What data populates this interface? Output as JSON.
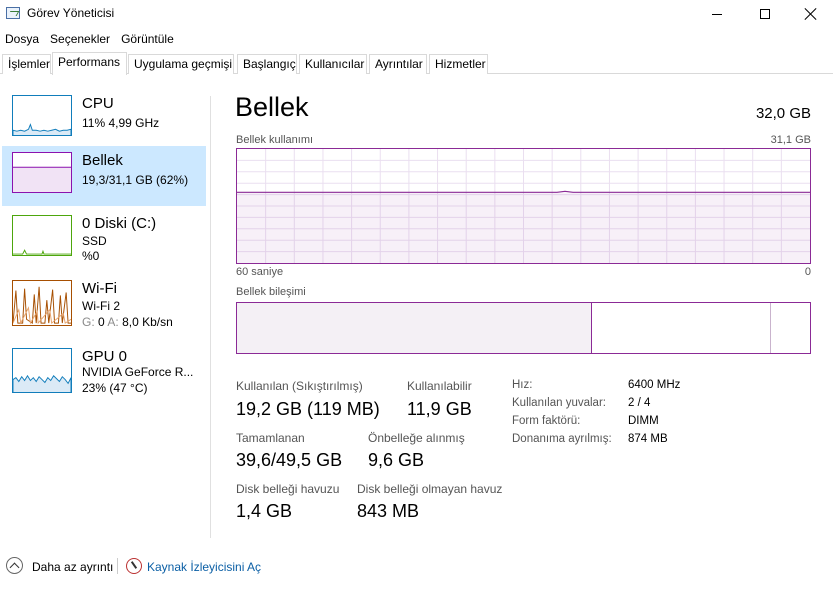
{
  "window": {
    "title": "Görev Yöneticisi"
  },
  "menu": [
    "Dosya",
    "Seçenekler",
    "Görüntüle"
  ],
  "tabs": [
    "İşlemler",
    "Performans",
    "Uygulama geçmişi",
    "Başlangıç",
    "Kullanıcılar",
    "Ayrıntılar",
    "Hizmetler"
  ],
  "active_tab": "Performans",
  "devices": [
    {
      "name": "CPU",
      "line1": "11%  4,99 GHz",
      "color": "#117dbb"
    },
    {
      "name": "Bellek",
      "line1": "19,3/31,1 GB (62%)",
      "color": "#8b12ae",
      "selected": true
    },
    {
      "name": "0 Diski (C:)",
      "line1": "SSD",
      "line2": "%0",
      "color": "#4da60c"
    },
    {
      "name": "Wi-Fi",
      "line1": "Wi-Fi 2",
      "line2_label_s": "G:",
      "line2_value_s": "0",
      "line2_label_a": "A:",
      "line2_value_a": "8,0 Kb/sn",
      "color": "#a74f01"
    },
    {
      "name": "GPU 0",
      "line1": "NVIDIA GeForce R...",
      "line2": "23%  (47 °C)",
      "color": "#117dbb"
    }
  ],
  "memory": {
    "title": "Bellek",
    "total": "32,0 GB",
    "usage_label": "Bellek kullanımı",
    "usage_max": "31,1 GB",
    "time_left": "60 saniye",
    "time_right": "0",
    "usage_fraction": 0.62,
    "composition_label": "Bellek bileşimi",
    "composition_in_use_fraction": 0.62,
    "composition_standby_end_fraction": 0.93
  },
  "stats": {
    "in_use_label": "Kullanılan (Sıkıştırılmış)",
    "in_use_value": "19,2 GB (119 MB)",
    "available_label": "Kullanılabilir",
    "available_value": "11,9 GB",
    "committed_label": "Tamamlanan",
    "committed_value": "39,6/49,5 GB",
    "cached_label": "Önbelleğe alınmış",
    "cached_value": "9,6 GB",
    "paged_label": "Disk belleği havuzu",
    "paged_value": "1,4 GB",
    "nonpaged_label": "Disk belleği olmayan havuz",
    "nonpaged_value": "843 MB"
  },
  "details": [
    {
      "label": "Hız:",
      "value": "6400 MHz"
    },
    {
      "label": "Kullanılan yuvalar:",
      "value": "2 / 4"
    },
    {
      "label": "Form faktörü:",
      "value": "DIMM"
    },
    {
      "label": "Donanıma ayrılmış:",
      "value": "874 MB"
    }
  ],
  "footer": {
    "fewer_details": "Daha az ayrıntı",
    "open_monitor": "Kaynak İzleyicisini Aç"
  },
  "colors": {
    "memory_accent": "#8b2a96",
    "selected_bg": "#cce8ff",
    "link": "#0b5fa5"
  }
}
